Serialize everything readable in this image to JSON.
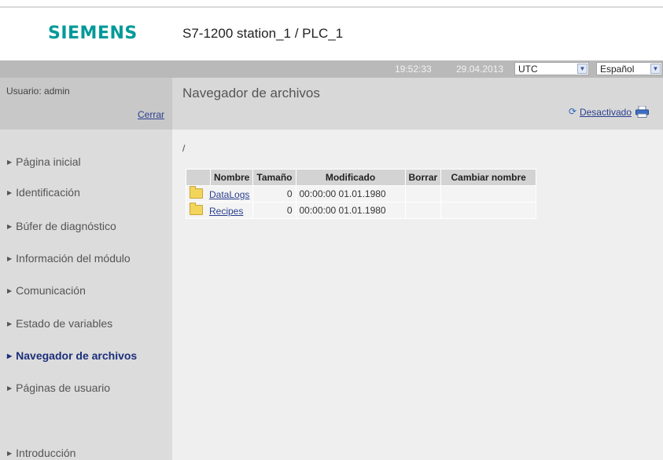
{
  "brand": {
    "logo": "SIEMENS",
    "station_title": "S7-1200 station_1 / PLC_1"
  },
  "topbar": {
    "time": "19:52:33",
    "date": "29.04.2013",
    "timezone": "UTC",
    "language": "Español"
  },
  "sidebar": {
    "user": "Usuario: admin",
    "logout_label": "Cerrar",
    "items": [
      {
        "label": "Página inicial",
        "active": false
      },
      {
        "label": "Identificación",
        "active": false
      },
      {
        "label": "Búfer de diagnóstico",
        "active": false
      },
      {
        "label": "Información del módulo",
        "active": false
      },
      {
        "label": "Comunicación",
        "active": false
      },
      {
        "label": "Estado de variables",
        "active": false
      },
      {
        "label": "Navegador de archivos",
        "active": true
      },
      {
        "label": "Páginas de usuario",
        "active": false
      },
      {
        "label": "Introducción",
        "active": false
      }
    ]
  },
  "main": {
    "title": "Navegador de archivos",
    "status_link": "Desactivado",
    "path": "/",
    "columns": [
      "Nombre",
      "Tamaño",
      "Modificado",
      "Borrar",
      "Cambiar nombre"
    ],
    "rows": [
      {
        "name": "DataLogs",
        "size": "0",
        "modified": "00:00:00 01.01.1980",
        "delete": "",
        "rename": ""
      },
      {
        "name": "Recipes",
        "size": "0",
        "modified": "00:00:00 01.01.1980",
        "delete": "",
        "rename": ""
      }
    ]
  },
  "icons": {
    "refresh": "refresh-icon",
    "print": "printer-icon",
    "folder": "folder-icon",
    "dropdown": "chevron-down-icon"
  },
  "colors": {
    "brand": "#009999",
    "link": "#2a3f8f",
    "topbar": "#b9b9b9",
    "sidebar": "#dcdcdc"
  }
}
